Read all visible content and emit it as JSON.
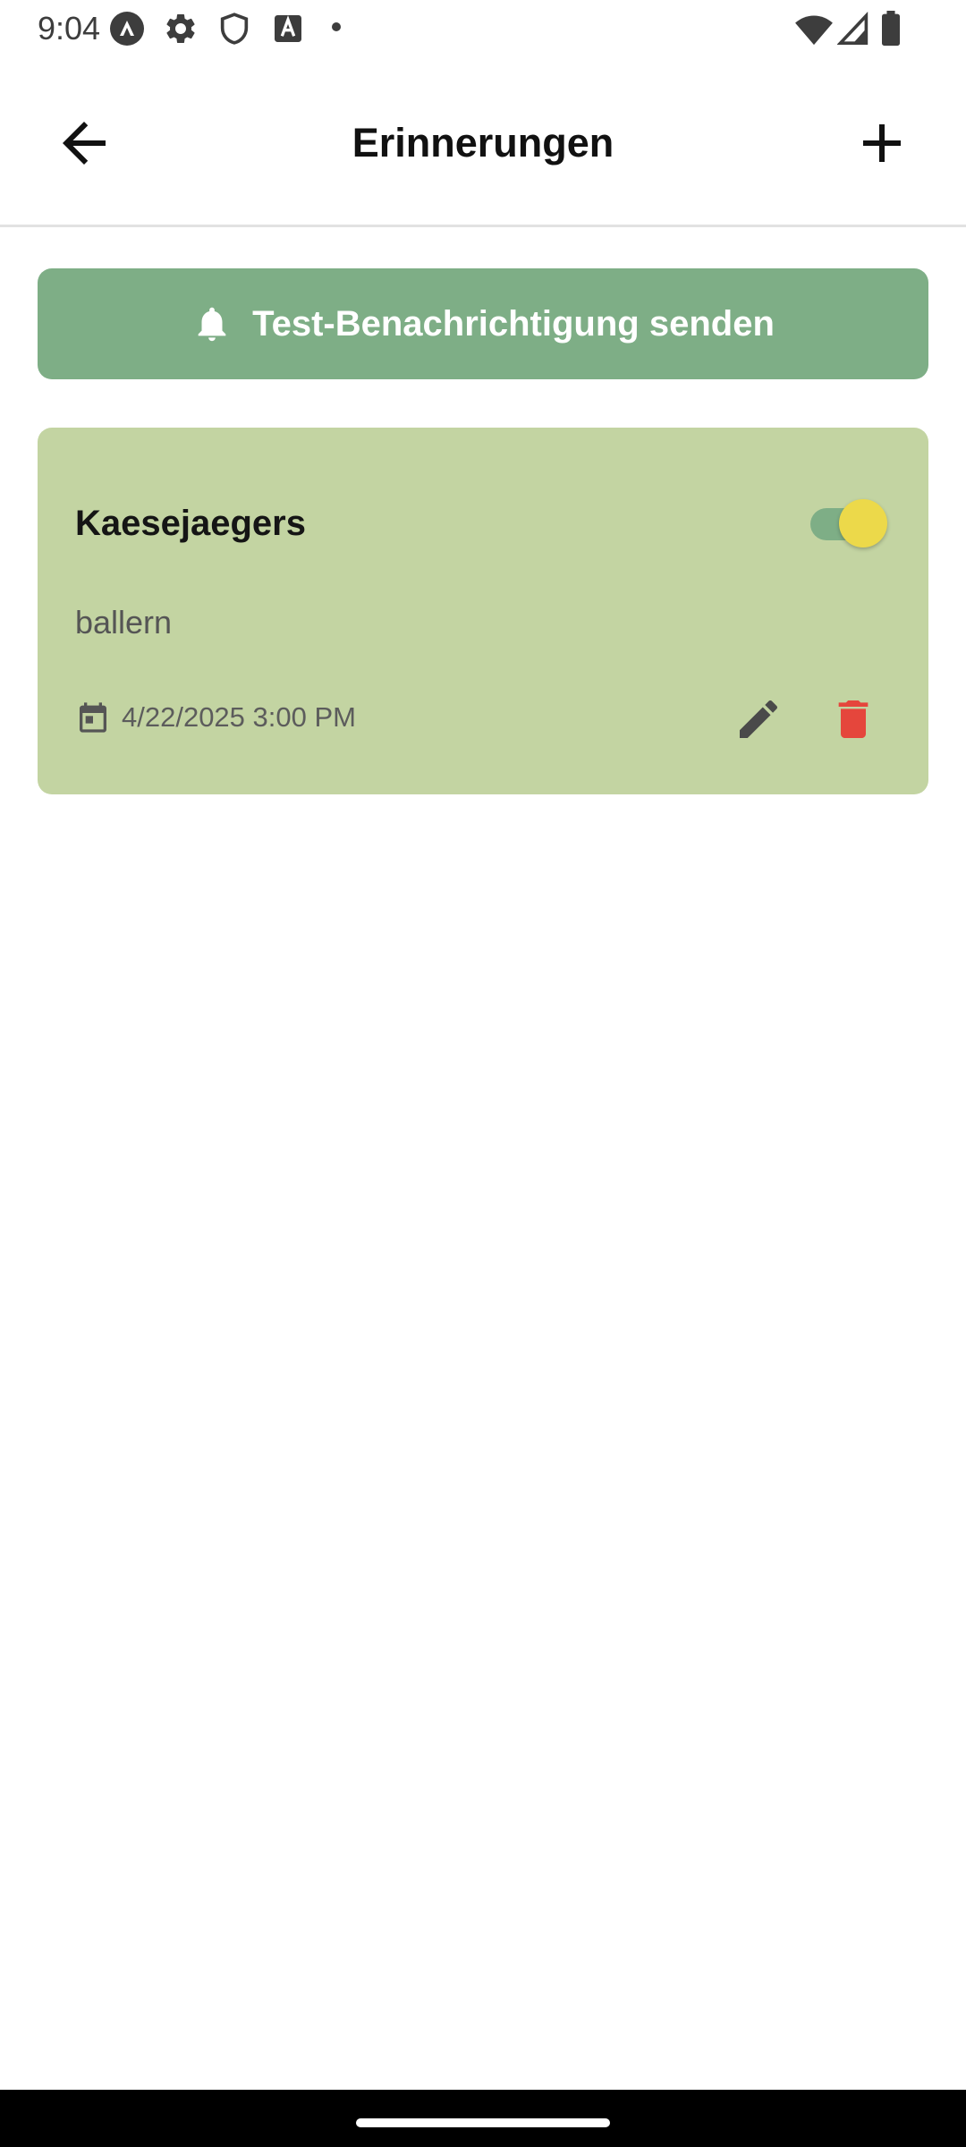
{
  "status_bar": {
    "time": "9:04",
    "icons": [
      "nav-app-icon",
      "gear-icon",
      "shield-icon",
      "text-a-icon",
      "dot-icon",
      "wifi-icon",
      "signal-icon",
      "battery-icon"
    ]
  },
  "app_bar": {
    "title": "Erinnerungen",
    "back_icon": "arrow-left-icon",
    "add_icon": "plus-icon"
  },
  "test_button": {
    "label": "Test-Benachrichtigung senden",
    "icon": "bell-icon"
  },
  "reminders": [
    {
      "title": "Kaesejaegers",
      "description": "ballern",
      "datetime": "4/22/2025 3:00 PM",
      "enabled": true
    }
  ],
  "colors": {
    "accent_green": "#7eae86",
    "card_background": "#c3d4a2",
    "toggle_thumb": "#ecd94a",
    "delete_red": "#e5463c"
  }
}
